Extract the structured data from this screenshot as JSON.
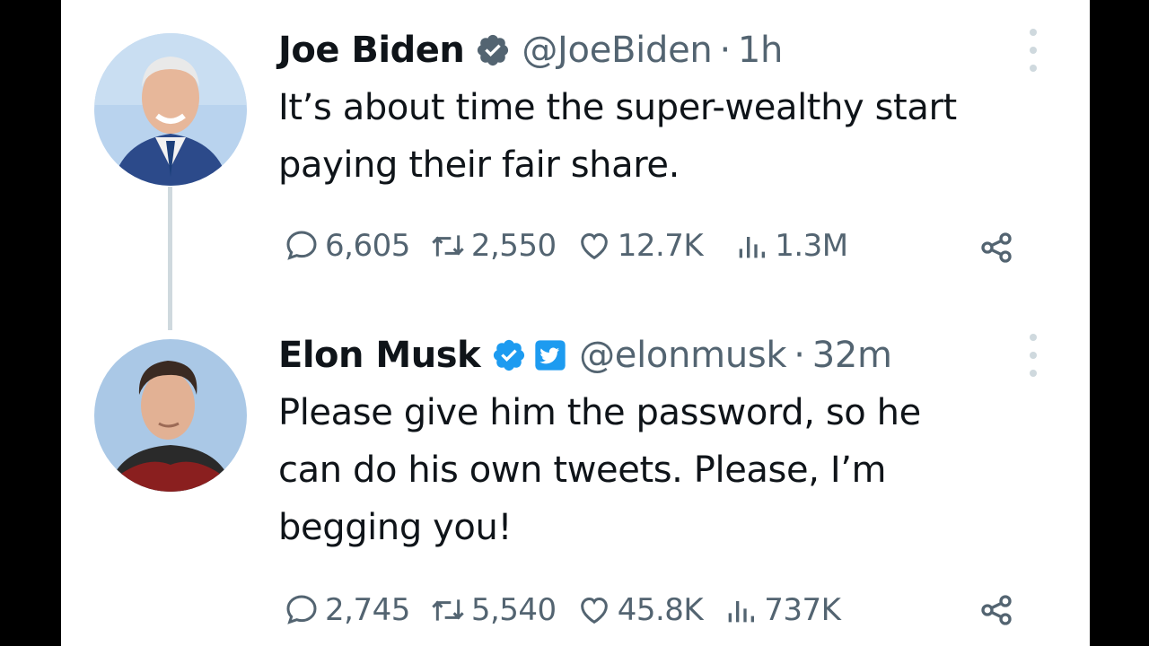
{
  "thread": [
    {
      "author_name": "Joe Biden",
      "handle": "@JoeBiden",
      "separator": "·",
      "time": "1h",
      "text_lines": [
        "It’s about time the super-wealthy start",
        "paying their fair share."
      ],
      "stats": {
        "replies": "6,605",
        "retweets": "2,550",
        "likes": "12.7K",
        "views": "1.3M"
      },
      "badges": [
        "verified-icon"
      ]
    },
    {
      "author_name": "Elon Musk",
      "handle": "@elonmusk",
      "separator": "·",
      "time": "32m",
      "text_lines": [
        "Please give him the password, so he",
        "can do his own tweets. Please, I’m",
        "begging you!"
      ],
      "stats": {
        "replies": "2,745",
        "retweets": "5,540",
        "likes": "45.8K",
        "views": "737K"
      },
      "badges": [
        "verified-icon",
        "twitter-bird-badge-icon"
      ]
    }
  ],
  "colors": {
    "primary_text": "#0f1419",
    "secondary_text": "#536471",
    "verified_blue": "#1d9bf0",
    "line": "#cfd9de"
  }
}
